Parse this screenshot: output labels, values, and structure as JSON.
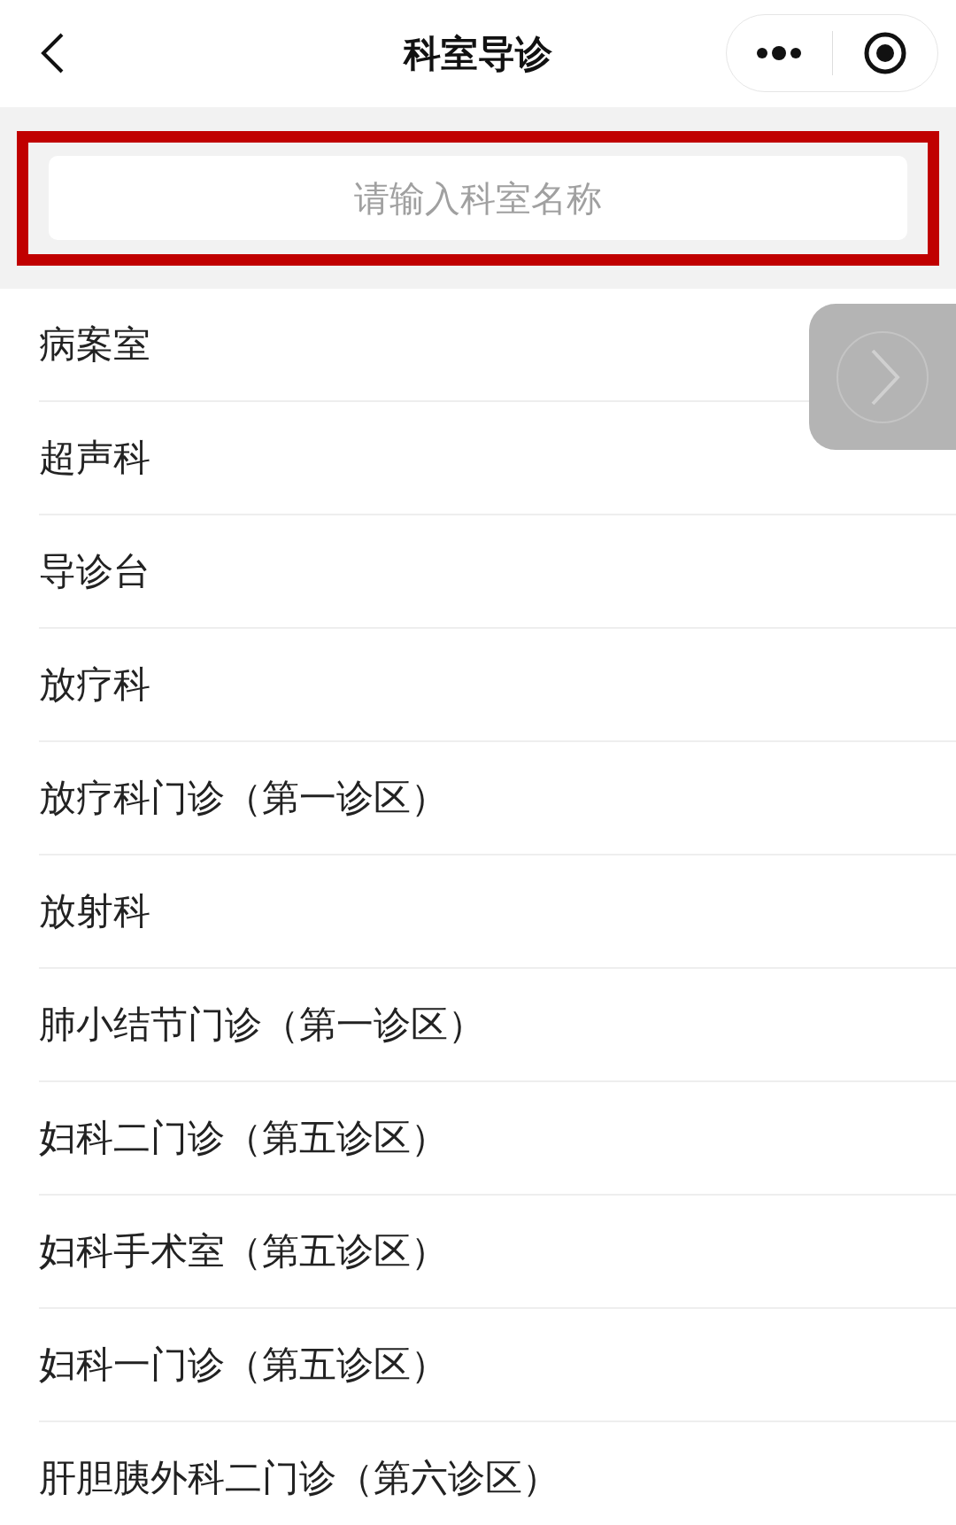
{
  "header": {
    "title": "科室导诊"
  },
  "search": {
    "placeholder": "请输入科室名称"
  },
  "departments": [
    {
      "name": "病案室"
    },
    {
      "name": "超声科"
    },
    {
      "name": "导诊台"
    },
    {
      "name": "放疗科"
    },
    {
      "name": "放疗科门诊（第一诊区）"
    },
    {
      "name": "放射科"
    },
    {
      "name": "肺小结节门诊（第一诊区）"
    },
    {
      "name": "妇科二门诊（第五诊区）"
    },
    {
      "name": "妇科手术室（第五诊区）"
    },
    {
      "name": "妇科一门诊（第五诊区）"
    },
    {
      "name": "肝胆胰外科二门诊（第六诊区）"
    }
  ]
}
